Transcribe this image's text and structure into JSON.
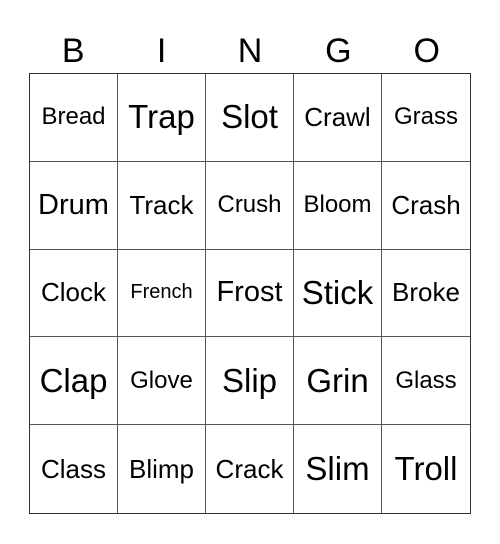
{
  "header": [
    "B",
    "I",
    "N",
    "G",
    "O"
  ],
  "cells": [
    [
      "Bread",
      "Trap",
      "Slot",
      "Crawl",
      "Grass"
    ],
    [
      "Drum",
      "Track",
      "Crush",
      "Bloom",
      "Crash"
    ],
    [
      "Clock",
      "French",
      "Frost",
      "Stick",
      "Broke"
    ],
    [
      "Clap",
      "Glove",
      "Slip",
      "Grin",
      "Glass"
    ],
    [
      "Class",
      "Blimp",
      "Crack",
      "Slim",
      "Troll"
    ]
  ]
}
